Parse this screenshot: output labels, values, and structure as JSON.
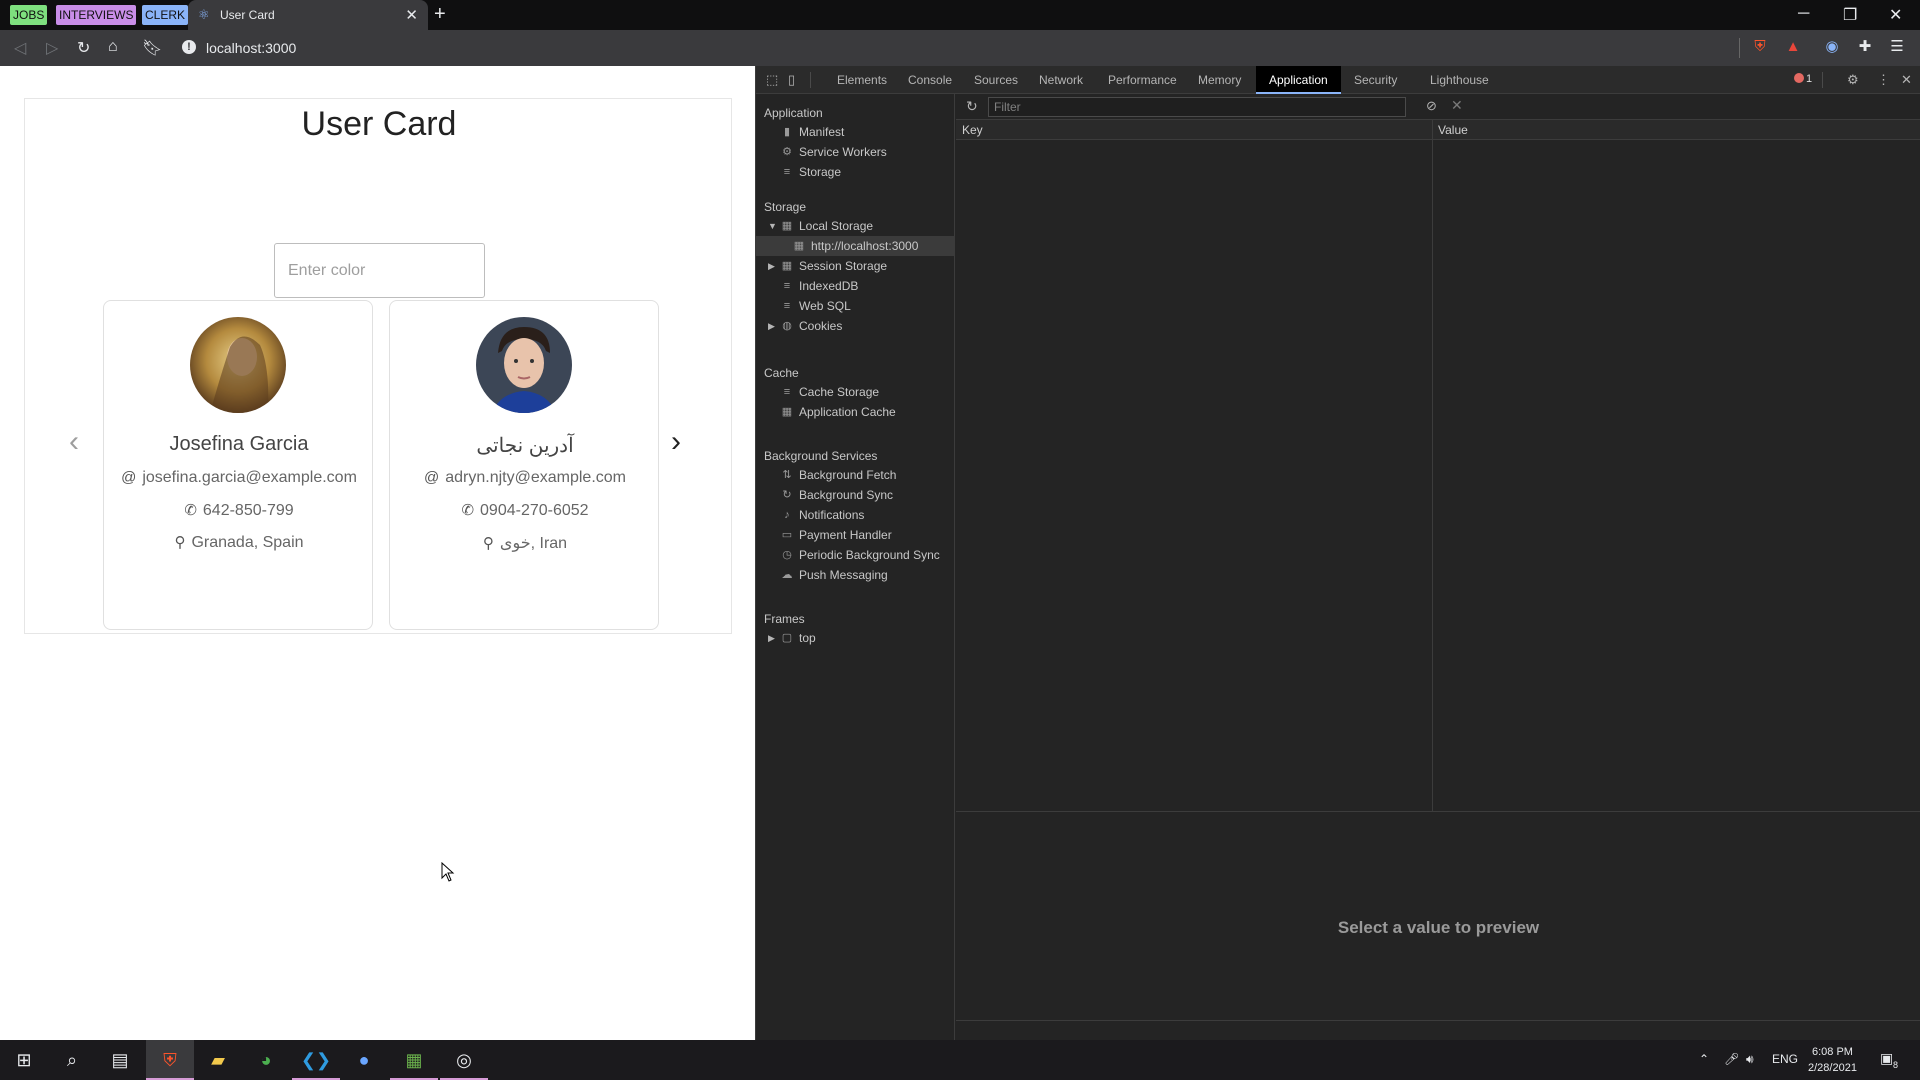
{
  "browser": {
    "bookmarks": [
      {
        "label": "JOBS",
        "color": "#7ee07e"
      },
      {
        "label": "INTERVIEWS",
        "color": "#c98ee8"
      },
      {
        "label": "CLERK",
        "color": "#8ab4f8"
      }
    ],
    "active_tab": {
      "title": "User Card",
      "favicon": "react-icon"
    },
    "url": "localhost:3000"
  },
  "page": {
    "title": "User Card",
    "color_input": {
      "placeholder": "Enter color",
      "value": ""
    },
    "cards": [
      {
        "name": "Josefina Garcia",
        "email": "josefina.garcia@example.com",
        "phone": "642-850-799",
        "location": "Granada, Spain",
        "avatar_colors": [
          "#6b4a2a",
          "#c9a85a"
        ]
      },
      {
        "name": "آدرین نجاتی",
        "email": "adryn.njty@example.com",
        "phone": "0904-270-6052",
        "location": "خوی, Iran",
        "avatar_colors": [
          "#2d3a4f",
          "#e6c2aa"
        ]
      }
    ],
    "prev_icon": "chevron-left-icon",
    "next_icon": "chevron-right-icon"
  },
  "devtools": {
    "tabs": [
      {
        "label": "Elements",
        "active": false
      },
      {
        "label": "Console",
        "active": false
      },
      {
        "label": "Sources",
        "active": false
      },
      {
        "label": "Network",
        "active": false
      },
      {
        "label": "Performance",
        "active": false
      },
      {
        "label": "Memory",
        "active": false
      },
      {
        "label": "Application",
        "active": true
      },
      {
        "label": "Security",
        "active": false
      },
      {
        "label": "Lighthouse",
        "active": false
      }
    ],
    "error_count": "1",
    "sidebar": {
      "application": {
        "title": "Application",
        "items": [
          "Manifest",
          "Service Workers",
          "Storage"
        ]
      },
      "storage": {
        "title": "Storage",
        "local_storage": "Local Storage",
        "local_origin": "http://localhost:3000",
        "session_storage": "Session Storage",
        "indexeddb": "IndexedDB",
        "websql": "Web SQL",
        "cookies": "Cookies"
      },
      "cache": {
        "title": "Cache",
        "items": [
          "Cache Storage",
          "Application Cache"
        ]
      },
      "background_services": {
        "title": "Background Services",
        "items": [
          "Background Fetch",
          "Background Sync",
          "Notifications",
          "Payment Handler",
          "Periodic Background Sync",
          "Push Messaging"
        ]
      },
      "frames": {
        "title": "Frames",
        "items": [
          "top"
        ]
      }
    },
    "filter_placeholder": "Filter",
    "columns": {
      "key": "Key",
      "value": "Value"
    },
    "preview_text": "Select a value to preview"
  },
  "taskbar": {
    "language": "ENG",
    "time": "6:08 PM",
    "date": "2/28/2021",
    "notification_count": "8"
  }
}
